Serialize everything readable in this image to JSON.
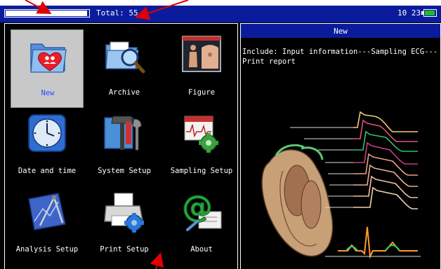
{
  "status_bar": {
    "total_label": "Total: 55",
    "clock": "10 23",
    "progress": 0.98,
    "battery_level": 0.9
  },
  "menu": {
    "items": [
      {
        "label": "New",
        "icon": "heart-folder-icon",
        "selected": true
      },
      {
        "label": "Archive",
        "icon": "archive-magnifier-icon",
        "selected": false
      },
      {
        "label": "Figure",
        "icon": "body-figure-icon",
        "selected": false
      },
      {
        "label": "Date and time",
        "icon": "clock-icon",
        "selected": false
      },
      {
        "label": "System Setup",
        "icon": "tools-icon",
        "selected": false
      },
      {
        "label": "Sampling Setup",
        "icon": "sampling-icon",
        "selected": false
      },
      {
        "label": "Analysis Setup",
        "icon": "analysis-icon",
        "selected": false
      },
      {
        "label": "Print Setup",
        "icon": "printer-icon",
        "selected": false
      },
      {
        "label": "About",
        "icon": "at-sign-icon",
        "selected": false
      }
    ]
  },
  "preview": {
    "title": "New",
    "description": "Include: Input information---Sampling ECG---Print report"
  },
  "colors": {
    "status_bar_bg": "#0a1c9c",
    "selected_label": "#2050ff",
    "selected_bg": "#c8c8c8",
    "annotation_arrow": "#e00000",
    "battery_fill": "#1fbf2a"
  }
}
